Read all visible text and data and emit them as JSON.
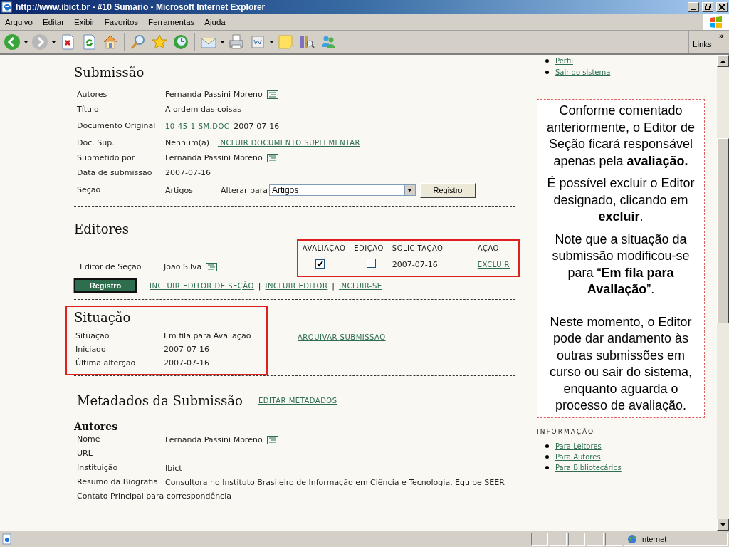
{
  "window": {
    "title": "http://www.ibict.br - #10 Sumário - Microsoft Internet Explorer"
  },
  "menu": [
    "Arquivo",
    "Editar",
    "Exibir",
    "Favoritos",
    "Ferramentas",
    "Ajuda"
  ],
  "links": {
    "label": "Links",
    "chevron": "»"
  },
  "submission": {
    "heading": "Submissão",
    "rows": [
      {
        "kind": "person",
        "label": "Autores",
        "value": "Fernanda Passini Moreno"
      },
      {
        "kind": "text",
        "label": "Título",
        "value": "A ordem das coisas"
      },
      {
        "kind": "file",
        "label": "Documento Original",
        "link": "10-45-1-SM.DOC",
        "value": "2007-07-16"
      },
      {
        "kind": "supp",
        "label": "Doc. Sup.",
        "value": "Nenhum(a)",
        "link": "INCLUIR DOCUMENTO SUPLEMENTAR"
      },
      {
        "kind": "person",
        "label": "Submetido por",
        "value": "Fernanda Passini Moreno"
      },
      {
        "kind": "text",
        "label": "Data de submissão",
        "value": "2007-07-16"
      },
      {
        "kind": "section",
        "label": "Seção",
        "value": "Artigos",
        "change_label": "Alterar para",
        "select_value": "Artigos",
        "button": "Registro"
      }
    ]
  },
  "editors": {
    "heading": "Editores",
    "columns": [
      "AVALIAÇÃO",
      "EDIÇÃO",
      "SOLICITAÇÃO",
      "AÇÃO"
    ],
    "rows": [
      {
        "role": "Editor de Seção",
        "name": "João Silva",
        "review": true,
        "editing": false,
        "requested": "2007-07-16",
        "action": "EXCLUIR"
      }
    ],
    "button": "Registro",
    "links": [
      "INCLUIR EDITOR DE SEÇÃO",
      "INCLUIR EDITOR",
      "INCLUIR-SE"
    ],
    "separator": "|"
  },
  "status": {
    "heading": "Situação",
    "rows": [
      {
        "label": "Situação",
        "value": "Em fila para Avaliação"
      },
      {
        "label": "Iniciado",
        "value": "2007-07-16"
      },
      {
        "label": "Última alterção",
        "value": "2007-07-16"
      }
    ],
    "link": "ARQUIVAR SUBMISSÃO"
  },
  "metadata": {
    "heading": "Metadados da Submissão",
    "link": "EDITAR METADADOS",
    "subheading": "Autores",
    "rows": [
      {
        "kind": "person",
        "label": "Nome",
        "value": "Fernanda Passini Moreno"
      },
      {
        "kind": "text",
        "label": "URL"
      },
      {
        "kind": "text",
        "label": "Instituição",
        "value": "Ibict"
      },
      {
        "kind": "text",
        "label": "Resumo da Biografia",
        "value": "Consultora no Instituto Brasileiro de Informação em Ciência e Tecnologia, Equipe SEER"
      },
      {
        "kind": "text",
        "label": "Contato Principal para correspondência"
      }
    ]
  },
  "sidebar": {
    "top_links": [
      "Perfil",
      "Sair do sistema"
    ],
    "note": [
      "Conforme comentado anteriormente, o Editor de Seção ficará responsável apenas pela **avaliação.**",
      "É possível excluir o Editor designado, clicando em **excluir**.",
      "Note que a situação da submissão modificou-se para “**Em fila para Avaliação**”.",
      "Neste momento, o Editor pode dar andamento às outras submissões em curso ou sair do sistema, enquanto aguarda o processo de avaliação."
    ],
    "info_heading": "INFORMAÇÃO",
    "info_links": [
      "Para Leitores",
      "Para Autores",
      "Para Bibliotecários"
    ]
  },
  "status_bar": {
    "zone": "Internet"
  }
}
